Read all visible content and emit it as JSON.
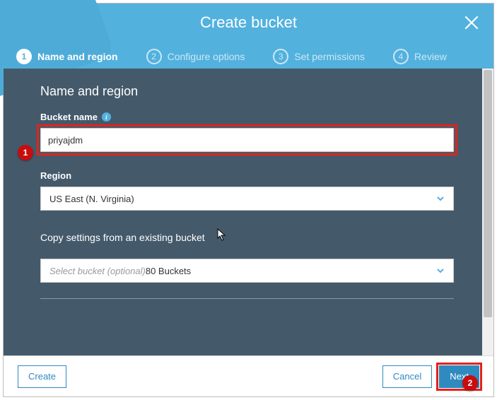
{
  "dialog": {
    "title": "Create bucket"
  },
  "steps": [
    {
      "num": "1",
      "label": "Name and region",
      "active": true
    },
    {
      "num": "2",
      "label": "Configure options",
      "active": false
    },
    {
      "num": "3",
      "label": "Set permissions",
      "active": false
    },
    {
      "num": "4",
      "label": "Review",
      "active": false
    }
  ],
  "form": {
    "section_title": "Name and region",
    "bucket_name_label": "Bucket name",
    "bucket_name_value": "priyajdm",
    "region_label": "Region",
    "region_value": "US East (N. Virginia)",
    "copy_label": "Copy settings from an existing bucket",
    "copy_placeholder": "Select bucket (optional)",
    "copy_count_suffix": "80 Buckets"
  },
  "footer": {
    "create": "Create",
    "cancel": "Cancel",
    "next": "Next"
  },
  "callouts": {
    "one": "1",
    "two": "2"
  }
}
